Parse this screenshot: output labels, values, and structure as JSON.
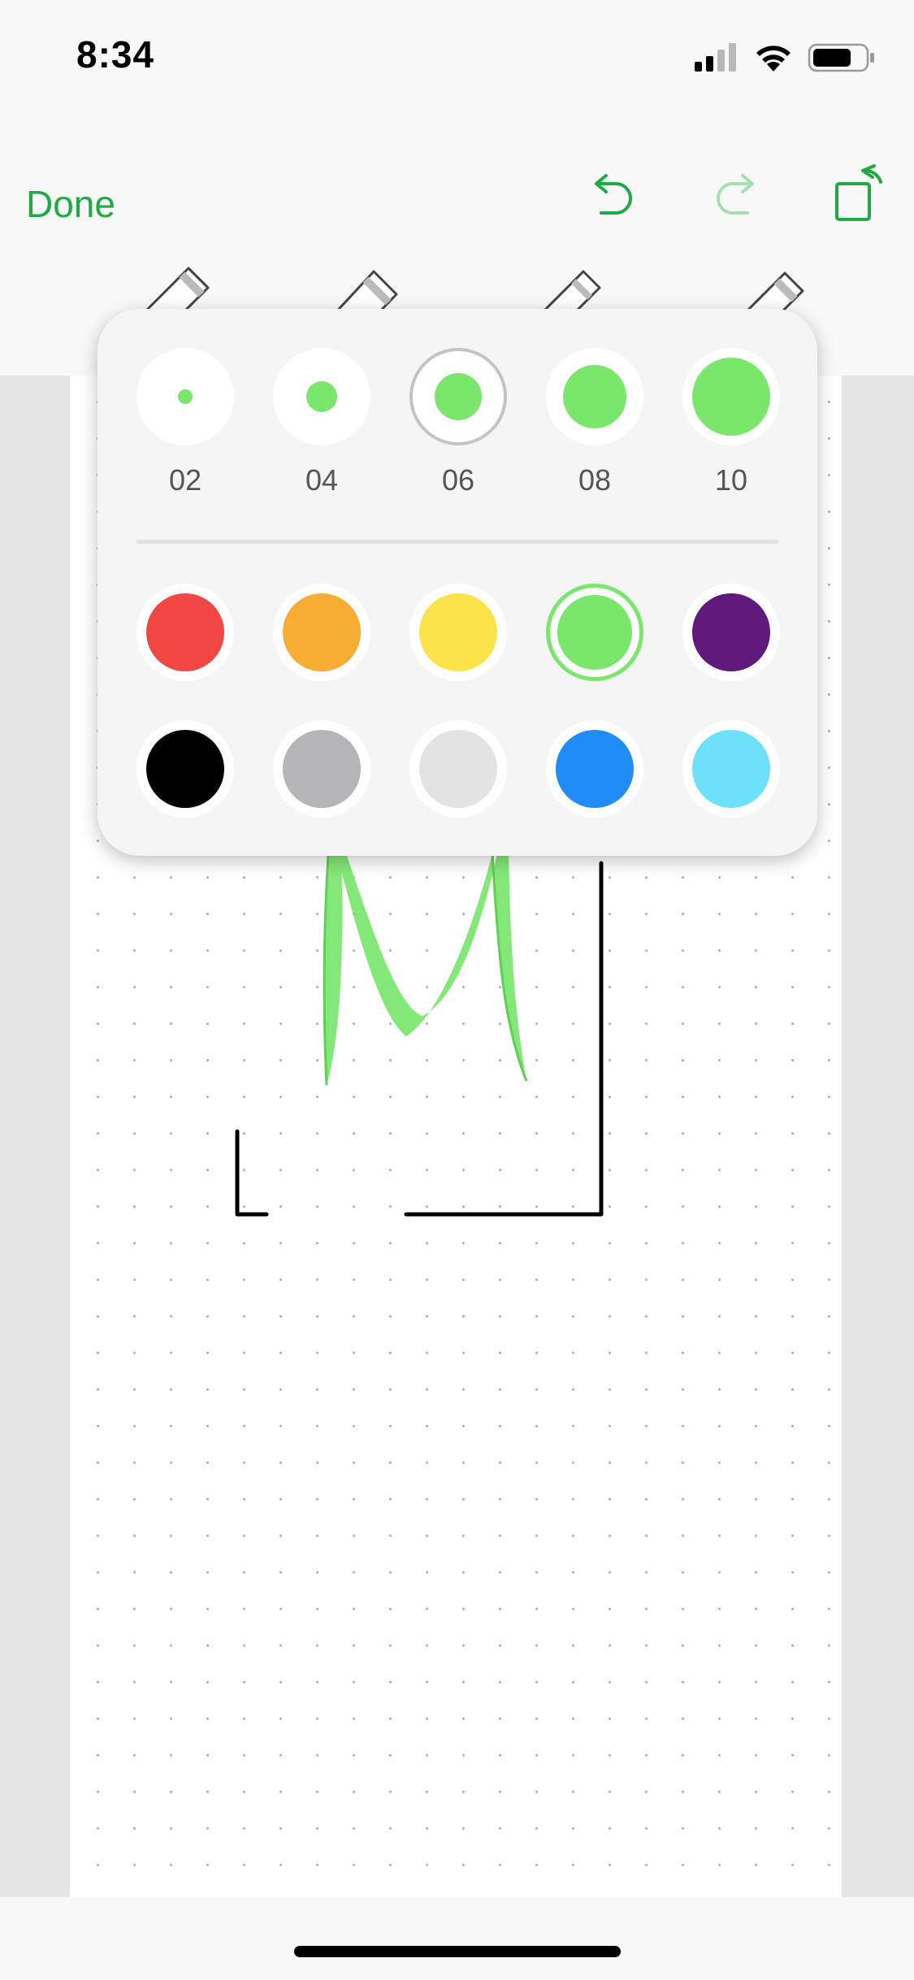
{
  "status_bar": {
    "time": "8:34"
  },
  "toolbar": {
    "done_label": "Done",
    "icons": [
      "undo-icon",
      "redo-icon",
      "rotate-page-icon"
    ],
    "tools": [
      "pencil-icon",
      "marker-icon",
      "brush-icon",
      "eraser-icon"
    ]
  },
  "popover": {
    "sizes": [
      {
        "label": "02",
        "selected": false
      },
      {
        "label": "04",
        "selected": false
      },
      {
        "label": "06",
        "selected": true
      },
      {
        "label": "08",
        "selected": false
      },
      {
        "label": "10",
        "selected": false
      }
    ],
    "colors": [
      {
        "name": "red",
        "hex": "#f04745",
        "selected": false
      },
      {
        "name": "orange",
        "hex": "#f7ad33",
        "selected": false
      },
      {
        "name": "yellow",
        "hex": "#fde34a",
        "selected": false
      },
      {
        "name": "green",
        "hex": "#7ae66c",
        "selected": true
      },
      {
        "name": "purple",
        "hex": "#5f1a7c",
        "selected": false
      },
      {
        "name": "black",
        "hex": "#000000",
        "selected": false
      },
      {
        "name": "gray",
        "hex": "#b5b5b7",
        "selected": false
      },
      {
        "name": "light-gray",
        "hex": "#e3e3e3",
        "selected": false
      },
      {
        "name": "blue",
        "hex": "#1f8df5",
        "selected": false
      },
      {
        "name": "cyan",
        "hex": "#6de1fc",
        "selected": false
      }
    ]
  },
  "colors": {
    "accent": "#1faa43",
    "ink_green": "#7ae66c"
  }
}
